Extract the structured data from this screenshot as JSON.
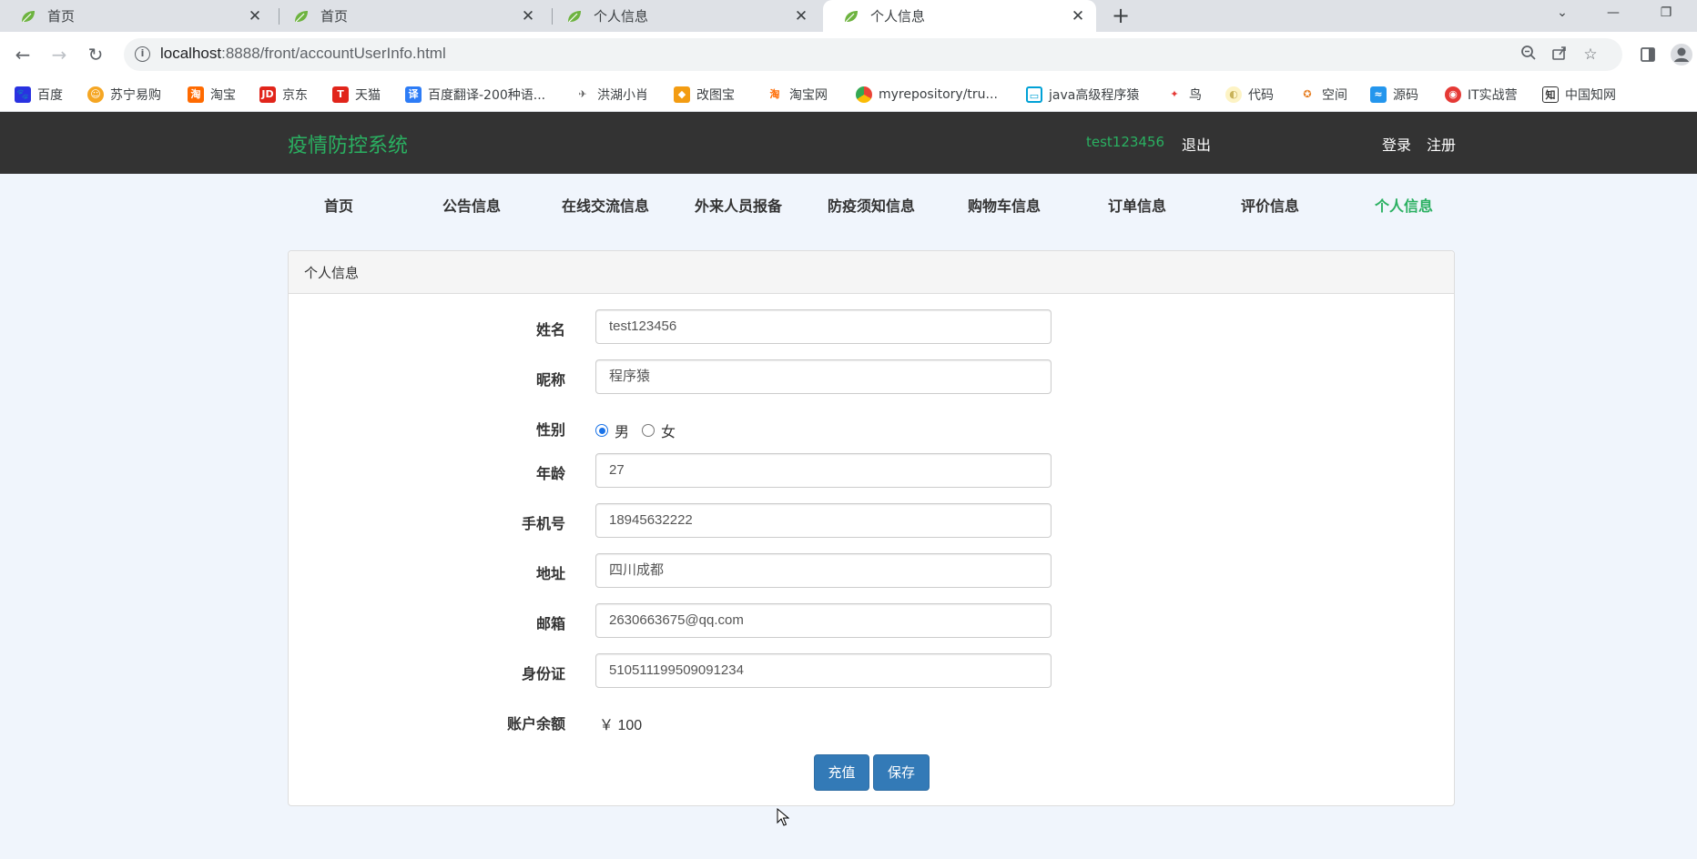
{
  "browser": {
    "tabs": [
      {
        "title": "首页",
        "active": false
      },
      {
        "title": "首页",
        "active": false
      },
      {
        "title": "个人信息",
        "active": false
      },
      {
        "title": "个人信息",
        "active": true
      }
    ],
    "url_host": "localhost",
    "url_path": ":8888/front/accountUserInfo.html",
    "bookmarks": [
      {
        "label": "百度",
        "icon": "baidu-icon",
        "color": "#2932e1"
      },
      {
        "label": "苏宁易购",
        "icon": "suning-icon",
        "color": "#f5a623"
      },
      {
        "label": "淘宝",
        "icon": "taobao-icon",
        "color": "#ff6a00"
      },
      {
        "label": "京东",
        "icon": "jd-icon",
        "color": "#e1251b"
      },
      {
        "label": "天猫",
        "icon": "tmall-icon",
        "color": "#e1251b"
      },
      {
        "label": "百度翻译-200种语...",
        "icon": "baidu-translate-icon",
        "color": "#2d7cf6"
      },
      {
        "label": "洪湖小肖",
        "icon": "bird-icon",
        "color": "#555555"
      },
      {
        "label": "改图宝",
        "icon": "gaitubao-icon",
        "color": "#f39c12"
      },
      {
        "label": "淘宝网",
        "icon": "taobao-icon",
        "color": "#ff6a00"
      },
      {
        "label": "myrepository/tru...",
        "icon": "chrome-icon",
        "color": "#34a853"
      },
      {
        "label": "java高级程序猿",
        "icon": "bilibili-icon",
        "color": "#00a1d6"
      },
      {
        "label": "鸟",
        "icon": "bird-red-icon",
        "color": "#e53935"
      },
      {
        "label": "代码",
        "icon": "moon-icon",
        "color": "#f5e7a1"
      },
      {
        "label": "空间",
        "icon": "space-icon",
        "color": "#e67e22"
      },
      {
        "label": "源码",
        "icon": "docker-icon",
        "color": "#2496ed"
      },
      {
        "label": "IT实战营",
        "icon": "it-icon",
        "color": "#e53935"
      },
      {
        "label": "中国知网",
        "icon": "cnki-icon",
        "color": "#333333"
      }
    ]
  },
  "header": {
    "logo": "疫情防控系统",
    "username": "test123456",
    "logout": "退出",
    "login": "登录",
    "register": "注册"
  },
  "nav": [
    {
      "label": "首页",
      "active": false
    },
    {
      "label": "公告信息",
      "active": false
    },
    {
      "label": "在线交流信息",
      "active": false
    },
    {
      "label": "外来人员报备",
      "active": false
    },
    {
      "label": "防疫须知信息",
      "active": false
    },
    {
      "label": "购物车信息",
      "active": false
    },
    {
      "label": "订单信息",
      "active": false
    },
    {
      "label": "评价信息",
      "active": false
    },
    {
      "label": "个人信息",
      "active": true
    }
  ],
  "panel": {
    "title": "个人信息",
    "fields": {
      "name": {
        "label": "姓名",
        "value": "test123456"
      },
      "nickname": {
        "label": "昵称",
        "value": "程序猿"
      },
      "gender": {
        "label": "性别",
        "options": [
          "男",
          "女"
        ],
        "selected": "男"
      },
      "age": {
        "label": "年龄",
        "value": "27"
      },
      "phone": {
        "label": "手机号",
        "value": "18945632222"
      },
      "address": {
        "label": "地址",
        "value": "四川成都"
      },
      "email": {
        "label": "邮箱",
        "value": "2630663675@qq.com"
      },
      "idcard": {
        "label": "身份证",
        "value": "510511199509091234"
      },
      "balance": {
        "label": "账户余额",
        "value": "￥ 100"
      }
    },
    "recharge_button": "充值",
    "save_button": "保存"
  },
  "colors": {
    "accent": "#2ab061",
    "header_bg": "#333333",
    "primary_button": "#337ab7",
    "page_bg": "#f0f5fc"
  }
}
